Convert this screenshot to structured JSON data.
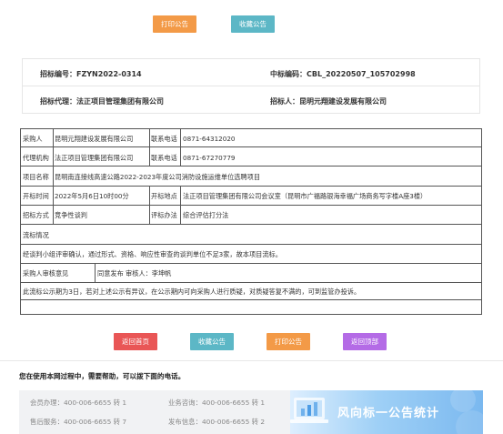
{
  "top_actions": {
    "print": "打印公告",
    "favorite": "收藏公告"
  },
  "info": {
    "tender_no_label": "招标编号：",
    "tender_no": "FZYN2022-0314",
    "platform_no_label": "中标编码：",
    "platform_no": "CBL_20220507_105702998",
    "agency_label": "招标代理：",
    "agency": "法正项目管理集团有限公司",
    "tenderer_label": "招标人：",
    "tenderer": "昆明元翔建设发展有限公司"
  },
  "detail": {
    "purchaser_label": "采购人",
    "purchaser": "昆明元翔建设发展有限公司",
    "phone_label": "联系电话",
    "purchaser_phone": "0871-64312020",
    "agency_label": "代理机构",
    "agency": "法正项目管理集团有限公司",
    "agency_phone": "0871-67270779",
    "project_label": "项目名称",
    "project": "昆明南连接线高速公路2022-2023年度公司消防设施运维单位选聘项目",
    "open_time_label": "开标时间",
    "open_time": "2022年5月6日10时00分",
    "open_place_label": "开标地点",
    "open_place": "法正项目管理集团有限公司会议室（昆明市广福路银海幸福广场商务写字楼A座3楼）",
    "method_label": "招标方式",
    "method": "竞争性谈判",
    "eval_label": "评标办法",
    "eval": "综合评估打分法",
    "status_label": "流标情况",
    "status_text": "经谈判小组评审确认，通过形式、资格、响应性审查的谈判单位不足3家，故本项目流标。",
    "review_label": "采购人审核意见",
    "review": "同意发布 审核人：李坤帆",
    "notice": "此流标公示期为3日，若对上述公示有异议，在公示期内可向采购人进行质疑，对质疑答复不满的，可到监管办投诉。"
  },
  "bottom_actions": {
    "home": "返回首页",
    "favorite": "收藏公告",
    "print": "打印公告",
    "top": "返回顶部"
  },
  "help": {
    "title": "您在使用本网过程中，需要帮助，可以拨下面的电话。",
    "member": "会员办理：400-006-6655 转 1",
    "business": "业务咨询：400-006-6655 转 1",
    "after_sales": "售后服务：400-006-6655 转 7",
    "publish": "发布信息：400-006-6655 转 2",
    "banner_text": "风向标一公告统计"
  },
  "colors": {
    "orange": "#f39a47",
    "teal": "#5cb7c6",
    "red": "#e95656",
    "purple": "#b46be6"
  }
}
